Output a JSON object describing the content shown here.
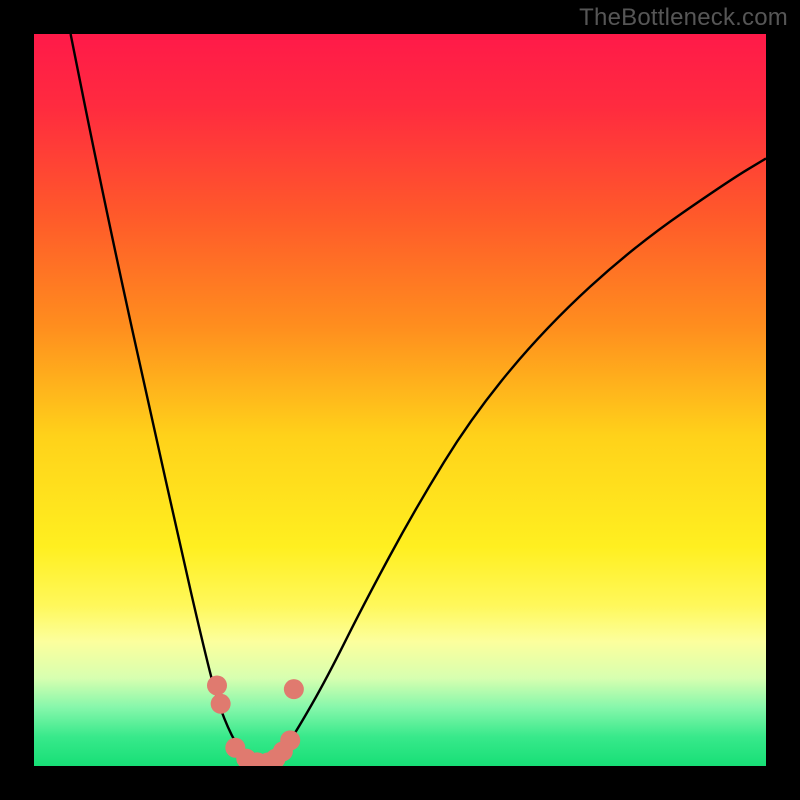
{
  "watermark": "TheBottleneck.com",
  "chart_data": {
    "type": "line",
    "title": "",
    "xlabel": "",
    "ylabel": "",
    "xlim": [
      0,
      100
    ],
    "ylim": [
      0,
      100
    ],
    "grid": false,
    "legend": false,
    "background_gradient": {
      "direction": "vertical",
      "stops": [
        {
          "pos": 0.0,
          "color": "#ff1a49"
        },
        {
          "pos": 0.1,
          "color": "#ff2b3f"
        },
        {
          "pos": 0.25,
          "color": "#ff5a2a"
        },
        {
          "pos": 0.4,
          "color": "#ff8e1e"
        },
        {
          "pos": 0.55,
          "color": "#ffd21a"
        },
        {
          "pos": 0.7,
          "color": "#ffef20"
        },
        {
          "pos": 0.78,
          "color": "#fff85a"
        },
        {
          "pos": 0.83,
          "color": "#fcff9d"
        },
        {
          "pos": 0.88,
          "color": "#d7ffb0"
        },
        {
          "pos": 0.92,
          "color": "#86f7ab"
        },
        {
          "pos": 0.96,
          "color": "#38e98b"
        },
        {
          "pos": 1.0,
          "color": "#17df76"
        }
      ]
    },
    "series": [
      {
        "name": "bottleneck-curve",
        "color": "#000000",
        "x": [
          5,
          8,
          12,
          16,
          20,
          23,
          25,
          27,
          29,
          30.5,
          32,
          34,
          36,
          40,
          45,
          52,
          60,
          70,
          82,
          95,
          100
        ],
        "y": [
          100,
          85,
          66,
          48,
          30,
          17,
          9,
          4,
          1,
          0,
          0.5,
          2,
          5,
          12,
          22,
          35,
          48,
          60,
          71,
          80,
          83
        ]
      }
    ],
    "markers": [
      {
        "name": "sample-points",
        "color": "#e07a6f",
        "radius": 10,
        "points": [
          {
            "x": 25.0,
            "y": 11.0
          },
          {
            "x": 25.5,
            "y": 8.5
          },
          {
            "x": 27.5,
            "y": 2.5
          },
          {
            "x": 29.0,
            "y": 1.0
          },
          {
            "x": 30.5,
            "y": 0.5
          },
          {
            "x": 32.0,
            "y": 0.5
          },
          {
            "x": 33.0,
            "y": 1.0
          },
          {
            "x": 34.0,
            "y": 2.0
          },
          {
            "x": 35.0,
            "y": 3.5
          },
          {
            "x": 35.5,
            "y": 10.5
          }
        ]
      }
    ]
  }
}
